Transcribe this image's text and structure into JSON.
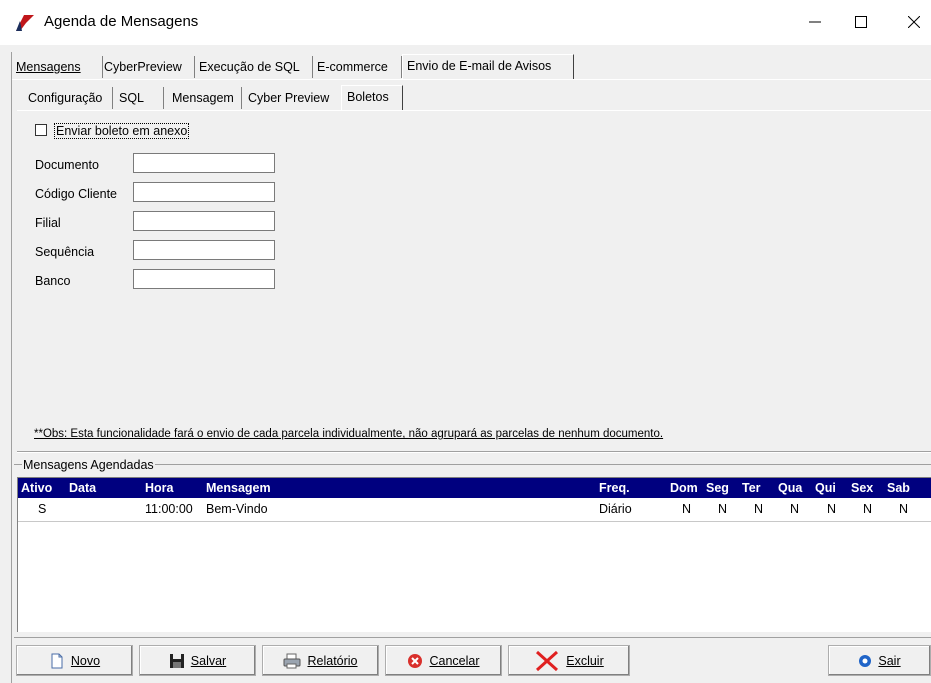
{
  "window": {
    "title": "Agenda de Mensagens",
    "controls": {
      "minimize": "—",
      "maximize": "☐",
      "close": "✕"
    }
  },
  "main_tabs": [
    {
      "label": "Mensagens",
      "active": false
    },
    {
      "label": "CyberPreview",
      "active": false
    },
    {
      "label": "Execução de SQL",
      "active": false
    },
    {
      "label": "E-commerce",
      "active": false
    },
    {
      "label": "Envio de E-mail de Avisos",
      "active": true
    }
  ],
  "sub_tabs": [
    {
      "label": "Configuração",
      "active": false
    },
    {
      "label": "SQL",
      "active": false
    },
    {
      "label": "Mensagem",
      "active": false
    },
    {
      "label": "Cyber Preview",
      "active": false
    },
    {
      "label": "Boletos",
      "active": true
    }
  ],
  "boletos": {
    "attach_checkbox_label": "Enviar boleto em anexo",
    "attach_checked": false,
    "fields": [
      {
        "label": "Documento",
        "value": ""
      },
      {
        "label": "Código Cliente",
        "value": ""
      },
      {
        "label": "Filial",
        "value": ""
      },
      {
        "label": "Sequência",
        "value": ""
      },
      {
        "label": "Banco",
        "value": ""
      }
    ],
    "note": "**Obs: Esta funcionalidade fará o envio de cada parcela individualmente, não agrupará as parcelas de nenhum documento."
  },
  "scheduled": {
    "group_label": "Mensagens Agendadas",
    "columns": [
      "Ativo",
      "Data",
      "Hora",
      "Mensagem",
      "Freq.",
      "Dom",
      "Seg",
      "Ter",
      "Qua",
      "Qui",
      "Sex",
      "Sab"
    ],
    "rows": [
      {
        "ativo": "S",
        "data": "",
        "hora": "11:00:00",
        "mensagem": "Bem-Vindo",
        "freq": "Diário",
        "dom": "N",
        "seg": "N",
        "ter": "N",
        "qua": "N",
        "qui": "N",
        "sex": "N",
        "sab": "N"
      }
    ]
  },
  "toolbar": {
    "novo": "Novo",
    "salvar": "Salvar",
    "relatorio": "Relatório",
    "cancelar": "Cancelar",
    "excluir": "Excluir",
    "sair": "Sair"
  },
  "colors": {
    "grid_header": "#00007f",
    "cancel_icon": "#d9302c",
    "exit_icon": "#1f64c8"
  }
}
